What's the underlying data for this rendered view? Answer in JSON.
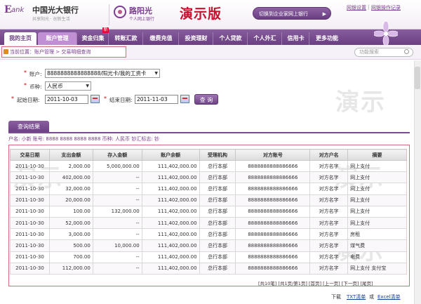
{
  "header": {
    "logo_e": "E",
    "logo_ank": "ank",
    "bank_name": "中国光大银行",
    "bank_slogan": "共享阳光 · 创新生活",
    "brand_name": "路阳光",
    "brand_sub": "个人网上银行",
    "demo_title": "演示版",
    "switch_button": "切换到企业家网上银行",
    "link_settings": "网银设置",
    "link_sep": "|",
    "link_log": "网银操作记录"
  },
  "nav": {
    "items": [
      "我的主页",
      "账户管理",
      "资金归集",
      "转账汇款",
      "缴费充值",
      "投资理财",
      "个人贷款",
      "个人外汇",
      "信用卡",
      "更多功能"
    ],
    "badge": "新"
  },
  "breadcrumb": "当前位置：账户管理 > 交易明细查询",
  "search": {
    "placeholder": "功能搜索"
  },
  "form": {
    "account_label": "账户:",
    "account_value": "8888888888888888/阳光卡/我的工资卡",
    "currency_label": "币种:",
    "currency_value": "人民币",
    "start_label": "起始日期:",
    "start_value": "2011-10-03",
    "end_label": "结束日期:",
    "end_value": "2011-11-03",
    "query_button": "查 询",
    "required_mark": "*"
  },
  "watermark": "演示",
  "results": {
    "tab_label": "查询结果",
    "account_line": "户名: 小新  账号: 8888 8888 8888 8888  币种: 人民币  钞汇标志: 钞",
    "columns": [
      "交易日期",
      "支出金额",
      "存入金额",
      "账户余额",
      "受理机构",
      "对方账号",
      "对方户名",
      "摘要"
    ],
    "rows": [
      [
        "2011-10-30",
        "2,000.00",
        "5,000,000.00",
        "111,402,000.00",
        "总行本部",
        "8888888888886666",
        "对方名字",
        "网上支付"
      ],
      [
        "2011-10-30",
        "402,000.00",
        "--",
        "111,402,000.00",
        "总行本部",
        "8888888888886666",
        "对方名字",
        "网上支付"
      ],
      [
        "2011-10-30",
        "32,000.00",
        "--",
        "111,402,000.00",
        "总行本部",
        "8888888888886666",
        "对方名字",
        "网上支付"
      ],
      [
        "2011-10-30",
        "20,000.00",
        "--",
        "111,402,000.00",
        "总行本部",
        "8888888888886666",
        "对方名字",
        "网上支付"
      ],
      [
        "2011-10-30",
        "100.00",
        "132,000.00",
        "111,402,000.00",
        "总行本部",
        "8888888888886666",
        "对方名字",
        "网上支付"
      ],
      [
        "2011-10-30",
        "52,000.00",
        "--",
        "111,402,000.00",
        "总行本部",
        "8888888888886666",
        "对方名字",
        "网上支付"
      ],
      [
        "2011-10-30",
        "3,000.00",
        "--",
        "111,402,000.00",
        "总行本部",
        "8888888888886666",
        "对方名字",
        "房租"
      ],
      [
        "2011-10-30",
        "500.00",
        "10,000.00",
        "111,402,000.00",
        "总行本部",
        "8888888888886666",
        "对方名字",
        "煤气费"
      ],
      [
        "2011-10-30",
        "700.00",
        "--",
        "111,402,000.00",
        "总行本部",
        "8888888888886666",
        "对方名字",
        "电费"
      ],
      [
        "2011-10-30",
        "112,000.00",
        "--",
        "111,402,000.00",
        "总行本部",
        "8888888888886666",
        "对方名字",
        "网上支付 支付宝"
      ]
    ],
    "pager": "[共10笔] [共1页/第1页] [首页] [上一页] [下一页] [尾页]",
    "download_label": "下载",
    "download_txt": "TXT清单",
    "download_or": "或",
    "download_excel": "Excel清单"
  }
}
